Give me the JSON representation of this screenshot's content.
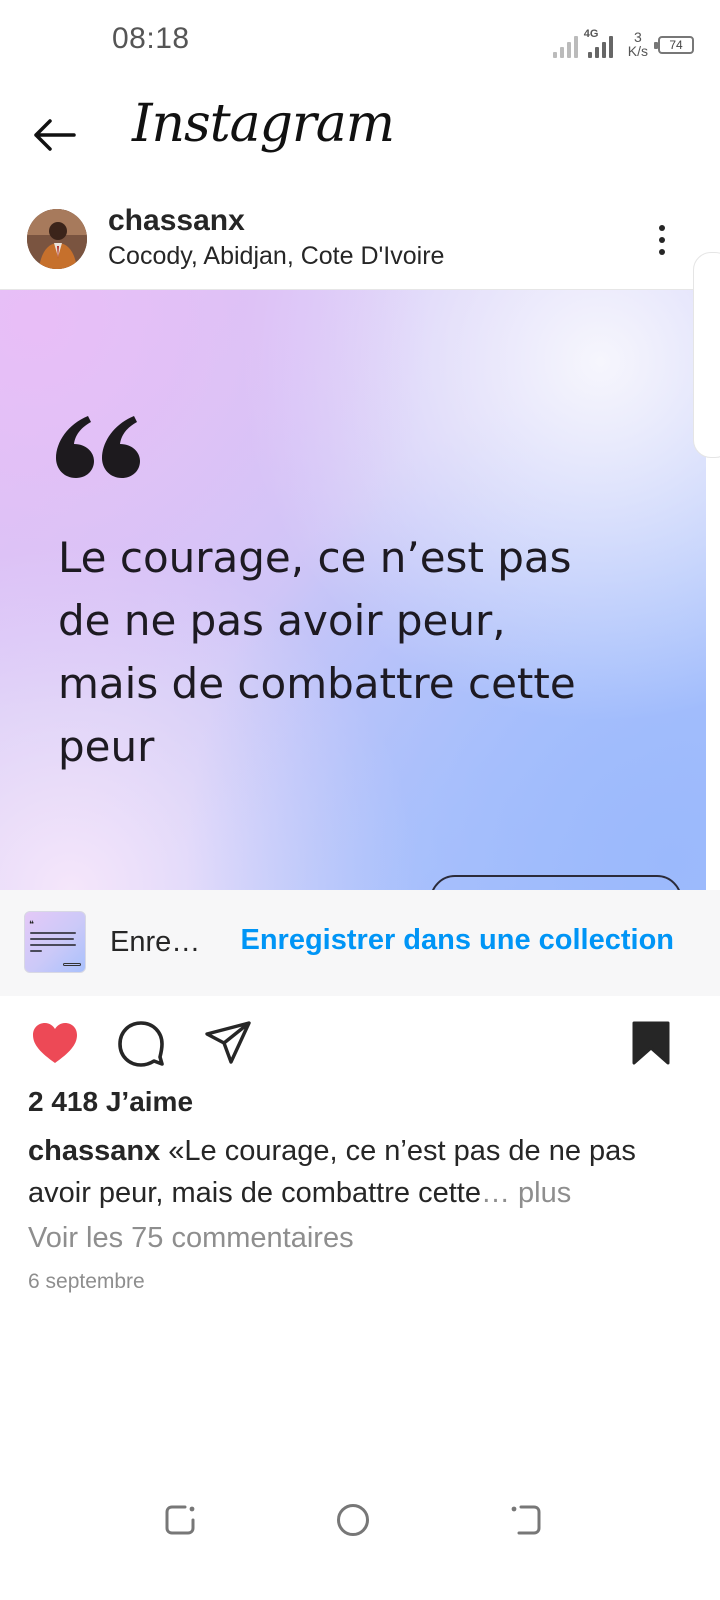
{
  "status_bar": {
    "time": "08:18",
    "network": "4G",
    "speed_value": "3",
    "speed_unit": "K/s",
    "battery": "74"
  },
  "header": {
    "app_name": "Instagram",
    "back_icon": "arrow-left-icon"
  },
  "post": {
    "username": "chassanx",
    "location": "Cocody, Abidjan, Cote D'Ivoire",
    "more_icon": "more-vertical-icon",
    "image": {
      "quote_icon": "quote-icon",
      "quote_text": "Le courage, ce n’est pas de ne pas avoir peur, mais de combattre cette peur"
    }
  },
  "save_bar": {
    "saved_label": "Enre…",
    "collection_label": "Enregistrer dans une collection"
  },
  "actions": {
    "like_icon": "heart-icon",
    "comment_icon": "comment-icon",
    "share_icon": "send-icon",
    "save_icon": "bookmark-icon",
    "liked": true,
    "saved": true
  },
  "meta": {
    "likes": "2 418 J’aime",
    "caption_user": "chassanx",
    "caption_text": " «Le courage, ce n’est pas de ne pas avoir peur, mais de combattre cette",
    "caption_more": "… plus",
    "comments_link": "Voir les 75 commentaires",
    "date": "6 septembre"
  },
  "nav_bar": {
    "recents_icon": "recents-icon",
    "home_icon": "home-icon",
    "back_icon": "back-nav-icon"
  },
  "colors": {
    "accent_blue": "#0095f6",
    "like_red": "#ed4956",
    "text": "#262626",
    "muted": "#8e8e8e"
  }
}
